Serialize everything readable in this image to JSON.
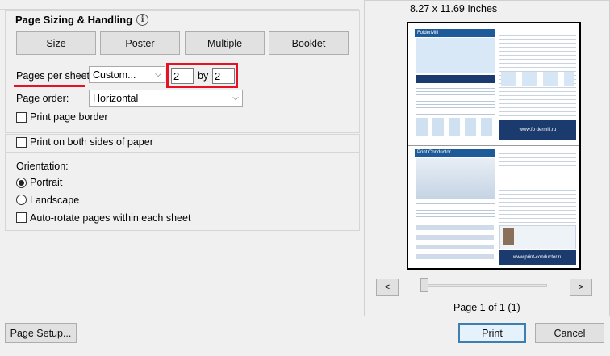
{
  "sizing": {
    "title": "Page Sizing & Handling",
    "info_icon": "i",
    "buttons": [
      "Size",
      "Poster",
      "Multiple",
      "Booklet"
    ],
    "pages_per_sheet_label": "Pages per sheet:",
    "pages_per_sheet_value": "Custom...",
    "cols": "2",
    "by": "by",
    "rows": "2",
    "page_order_label": "Page order:",
    "page_order_value": "Horizontal",
    "print_border_label": "Print page border"
  },
  "options": {
    "both_sides_label": "Print on both sides of paper",
    "orientation_label": "Orientation:",
    "portrait_label": "Portrait",
    "landscape_label": "Landscape",
    "autorotate_label": "Auto-rotate pages within each sheet"
  },
  "preview": {
    "paper_size": "8.27 x 11.69 Inches",
    "page_info": "Page 1 of 1 (1)",
    "prev": "<",
    "next": ">",
    "slider_position_fraction": 0,
    "doc": {
      "brand_top": "FolderMill",
      "brand_bottom": "Print Conductor",
      "site_top": "www.fo dermill.ru",
      "site_bottom": "www.print-conductor.ru"
    }
  },
  "footer": {
    "page_setup": "Page Setup...",
    "print": "Print",
    "cancel": "Cancel"
  },
  "colors": {
    "highlight_red": "#e81123",
    "doc_blue": "#1d5a9a",
    "doc_dark": "#1b3b6f"
  }
}
